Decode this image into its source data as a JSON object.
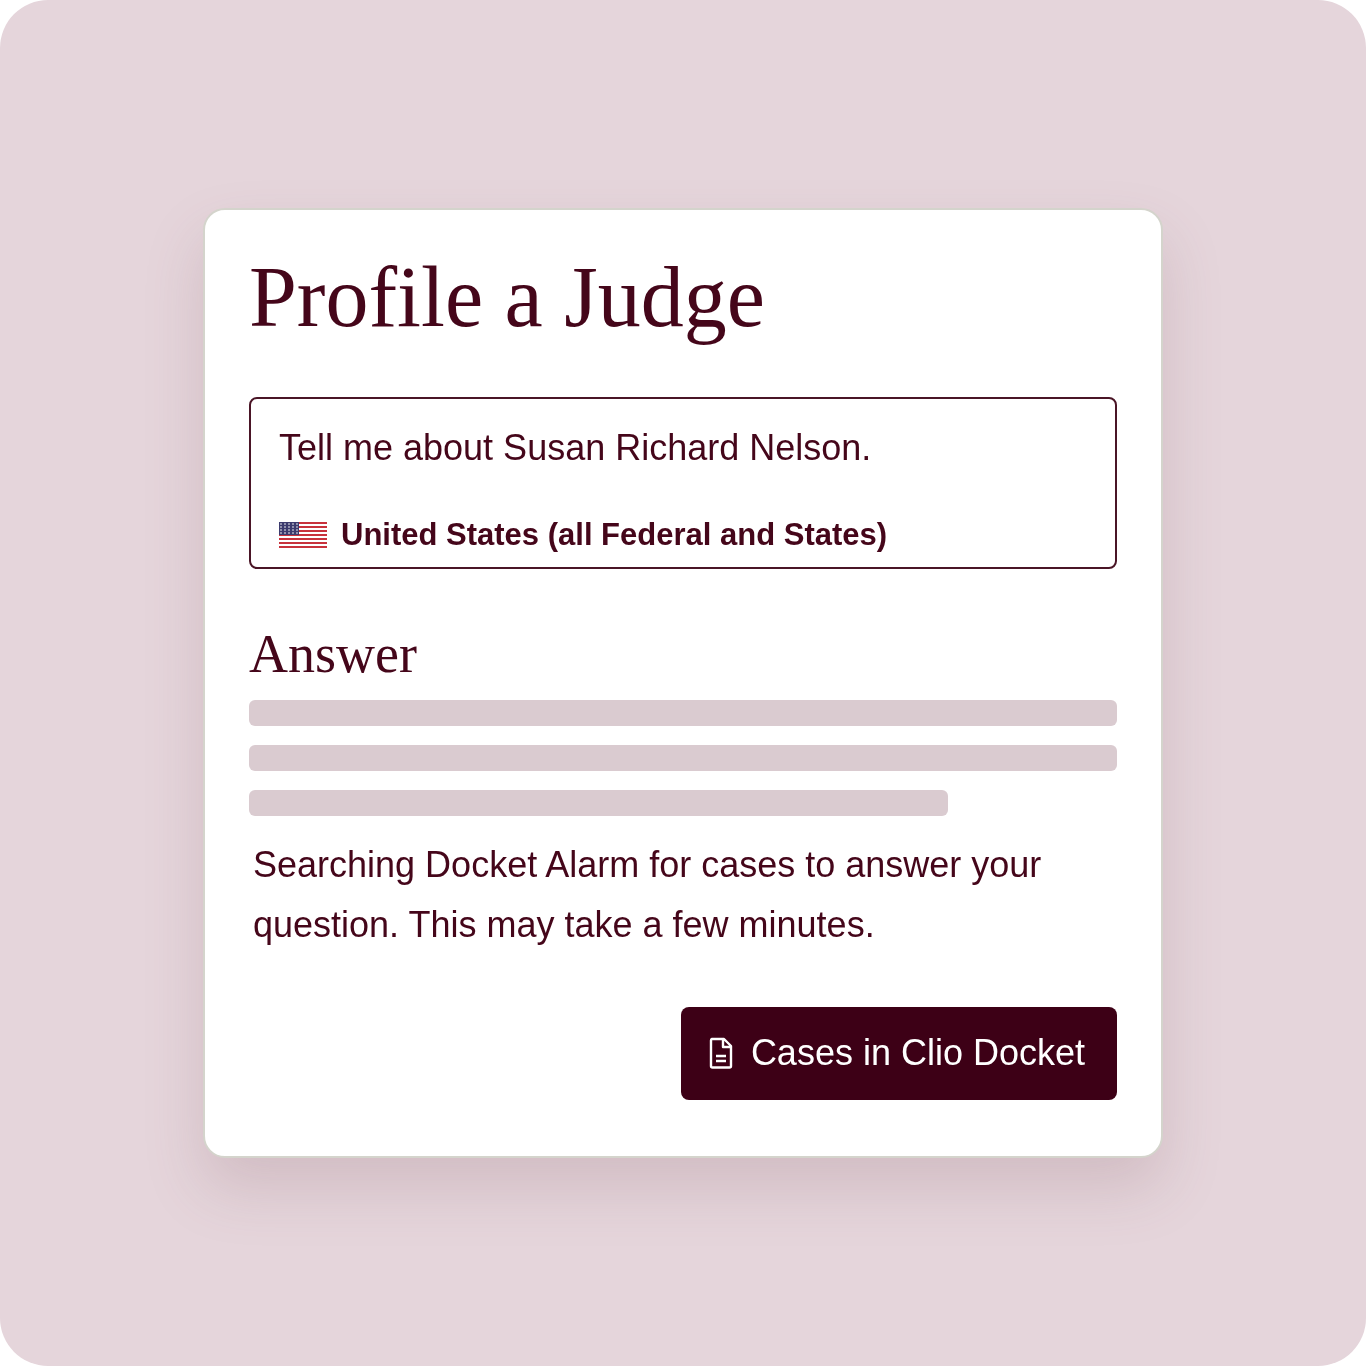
{
  "title": "Profile a Judge",
  "query": {
    "value": "Tell me about Susan Richard Nelson.",
    "jurisdiction": "United States (all Federal and States)"
  },
  "answer": {
    "heading": "Answer",
    "loading": true,
    "status": "Searching Docket Alarm for cases to answer your question. This may take a few minutes."
  },
  "button": {
    "label": "Cases in Clio Docket"
  }
}
